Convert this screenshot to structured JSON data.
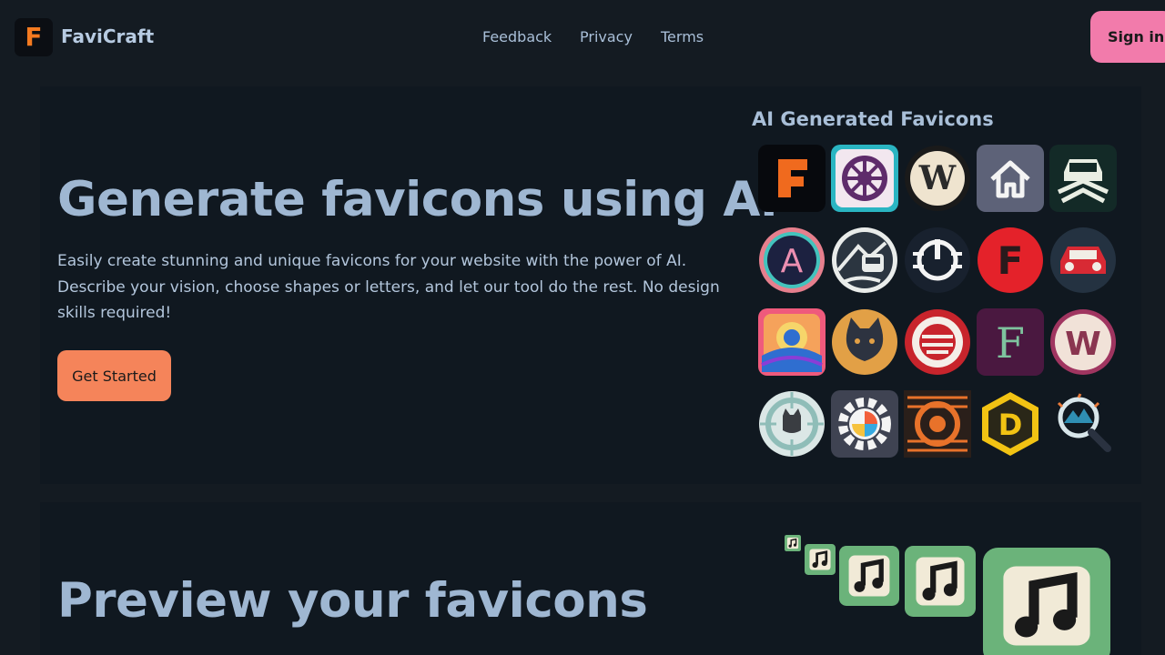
{
  "header": {
    "logo_letter": "F",
    "brand": "FaviCraft",
    "nav": [
      "Feedback",
      "Privacy",
      "Terms"
    ],
    "signin_label": "Sign in"
  },
  "hero": {
    "title": "Generate favicons using AI",
    "description": "Easily create stunning and unique favicons for your website with the power of AI. Describe your vision, choose shapes or letters, and let our tool do the rest. No design skills required!",
    "cta_label": "Get Started",
    "gallery_title": "AI Generated Favicons",
    "favicons": [
      {
        "icon": "letter-f-icon",
        "letter": "F"
      },
      {
        "icon": "ship-wheel-icon"
      },
      {
        "icon": "letter-w-icon",
        "letter": "W"
      },
      {
        "icon": "house-icon"
      },
      {
        "icon": "car-front-icon"
      },
      {
        "icon": "letter-a-icon",
        "letter": "A"
      },
      {
        "icon": "car-road-icon"
      },
      {
        "icon": "power-dial-icon"
      },
      {
        "icon": "letter-f-red-icon",
        "letter": "F"
      },
      {
        "icon": "red-car-icon"
      },
      {
        "icon": "sunset-location-icon"
      },
      {
        "icon": "cat-face-icon"
      },
      {
        "icon": "globe-emblem-icon"
      },
      {
        "icon": "letter-f-ornate-icon",
        "letter": "F"
      },
      {
        "icon": "letter-w-pink-icon",
        "letter": "W"
      },
      {
        "icon": "dog-target-icon"
      },
      {
        "icon": "color-gear-icon"
      },
      {
        "icon": "orange-target-icon"
      },
      {
        "icon": "letter-d-hexagon-icon",
        "letter": "D"
      },
      {
        "icon": "mountain-magnifier-icon"
      }
    ]
  },
  "preview": {
    "title": "Preview your favicons",
    "sample_icon": "music-note-icon"
  },
  "colors": {
    "background": "#141b22",
    "card": "#101820",
    "accent_orange": "#f5845a",
    "accent_pink": "#f27bab",
    "text": "#a9bfd8"
  }
}
